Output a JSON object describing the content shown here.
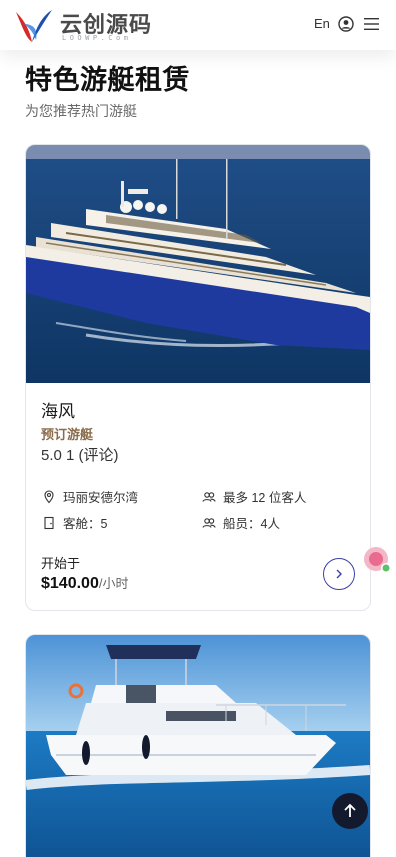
{
  "header": {
    "logo_text": "云创源码",
    "logo_sub": "LOOWP.Com",
    "lang_label": "En",
    "icons": [
      "user-circle-icon",
      "hamburger-menu-icon"
    ]
  },
  "section": {
    "title": "特色游艇租赁",
    "subtitle": "为您推荐热门游艇"
  },
  "cards": [
    {
      "name": "海风",
      "type": "预订游艇",
      "rating": "5.0 1 (评论)",
      "location": "玛丽安德尔湾",
      "guests": "最多 12 位客人",
      "cabins": "客舱：5",
      "crew": "船员：4人",
      "price_label": "开始于",
      "price": "$140.00",
      "price_unit": "/小时"
    },
    {
      "name": "",
      "image": "motor-yacht-photo"
    }
  ],
  "colors": {
    "accent": "#3b3fa8",
    "type_label": "#8a6d4a",
    "back_to_top": "#141a2e"
  }
}
